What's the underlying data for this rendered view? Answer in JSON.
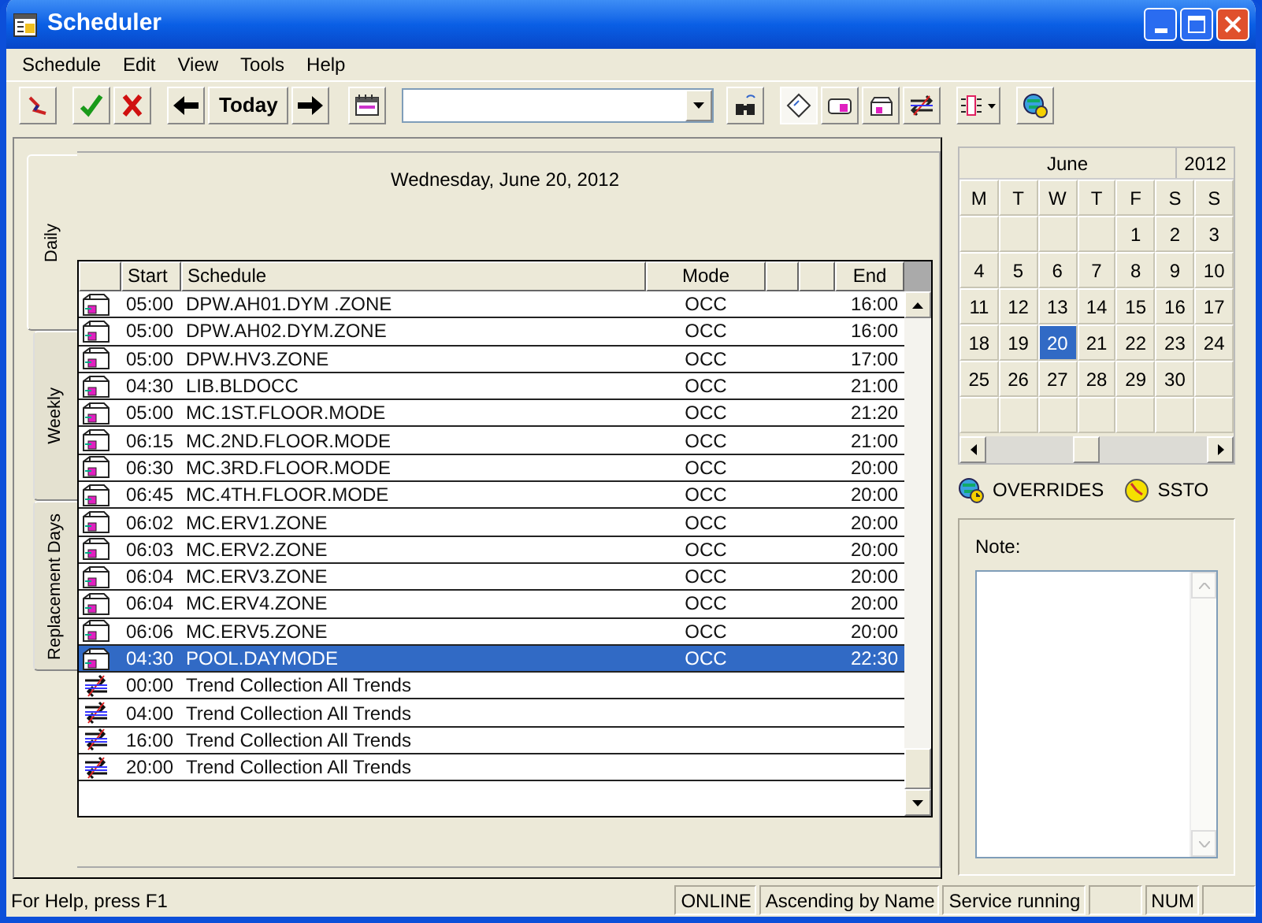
{
  "window": {
    "title": "Scheduler"
  },
  "menu": [
    "Schedule",
    "Edit",
    "View",
    "Tools",
    "Help"
  ],
  "toolbar": {
    "today_label": "Today"
  },
  "tabs": [
    {
      "label": "Daily",
      "selected": true
    },
    {
      "label": "Weekly",
      "selected": false
    },
    {
      "label": "Replacement Days",
      "selected": false
    }
  ],
  "date_heading": "Wednesday, June 20, 2012",
  "table": {
    "columns": [
      "Start",
      "Schedule",
      "Mode",
      "End"
    ],
    "rows": [
      {
        "kind": "schedule",
        "start": "05:00",
        "schedule": "DPW.AH01.DYM .ZONE",
        "mode": "OCC",
        "end": "16:00",
        "selected": false
      },
      {
        "kind": "schedule",
        "start": "05:00",
        "schedule": "DPW.AH02.DYM.ZONE",
        "mode": "OCC",
        "end": "16:00",
        "selected": false
      },
      {
        "kind": "schedule",
        "start": "05:00",
        "schedule": "DPW.HV3.ZONE",
        "mode": "OCC",
        "end": "17:00",
        "selected": false
      },
      {
        "kind": "schedule",
        "start": "04:30",
        "schedule": "LIB.BLDOCC",
        "mode": "OCC",
        "end": "21:00",
        "selected": false
      },
      {
        "kind": "schedule",
        "start": "05:00",
        "schedule": "MC.1ST.FLOOR.MODE",
        "mode": "OCC",
        "end": "21:20",
        "selected": false
      },
      {
        "kind": "schedule",
        "start": "06:15",
        "schedule": "MC.2ND.FLOOR.MODE",
        "mode": "OCC",
        "end": "21:00",
        "selected": false
      },
      {
        "kind": "schedule",
        "start": "06:30",
        "schedule": "MC.3RD.FLOOR.MODE",
        "mode": "OCC",
        "end": "20:00",
        "selected": false
      },
      {
        "kind": "schedule",
        "start": "06:45",
        "schedule": "MC.4TH.FLOOR.MODE",
        "mode": "OCC",
        "end": "20:00",
        "selected": false
      },
      {
        "kind": "schedule",
        "start": "06:02",
        "schedule": "MC.ERV1.ZONE",
        "mode": "OCC",
        "end": "20:00",
        "selected": false
      },
      {
        "kind": "schedule",
        "start": "06:03",
        "schedule": "MC.ERV2.ZONE",
        "mode": "OCC",
        "end": "20:00",
        "selected": false
      },
      {
        "kind": "schedule",
        "start": "06:04",
        "schedule": "MC.ERV3.ZONE",
        "mode": "OCC",
        "end": "20:00",
        "selected": false
      },
      {
        "kind": "schedule",
        "start": "06:04",
        "schedule": "MC.ERV4.ZONE",
        "mode": "OCC",
        "end": "20:00",
        "selected": false
      },
      {
        "kind": "schedule",
        "start": "06:06",
        "schedule": "MC.ERV5.ZONE",
        "mode": "OCC",
        "end": "20:00",
        "selected": false
      },
      {
        "kind": "schedule",
        "start": "04:30",
        "schedule": "POOL.DAYMODE",
        "mode": "OCC",
        "end": "22:30",
        "selected": true
      },
      {
        "kind": "trend",
        "start": "00:00",
        "schedule": "Trend Collection All Trends",
        "selected": false
      },
      {
        "kind": "trend",
        "start": "04:00",
        "schedule": "Trend Collection All Trends",
        "selected": false
      },
      {
        "kind": "trend",
        "start": "16:00",
        "schedule": "Trend Collection All Trends",
        "selected": false
      },
      {
        "kind": "trend",
        "start": "20:00",
        "schedule": "Trend Collection All Trends",
        "selected": false
      }
    ]
  },
  "calendar": {
    "month": "June",
    "year": "2012",
    "weekdays": [
      "M",
      "T",
      "W",
      "T",
      "F",
      "S",
      "S"
    ],
    "weeks": [
      [
        {
          "kind": "blank"
        },
        {
          "kind": "blank"
        },
        {
          "kind": "blank"
        },
        {
          "kind": "blank"
        },
        {
          "day": "1",
          "selected": false
        },
        {
          "day": "2",
          "selected": false
        },
        {
          "day": "3",
          "selected": false
        }
      ],
      [
        {
          "day": "4",
          "selected": false
        },
        {
          "day": "5",
          "selected": false
        },
        {
          "day": "6",
          "selected": false
        },
        {
          "day": "7",
          "selected": false
        },
        {
          "day": "8",
          "selected": false
        },
        {
          "day": "9",
          "selected": false
        },
        {
          "day": "10",
          "selected": false
        }
      ],
      [
        {
          "day": "11",
          "selected": false
        },
        {
          "day": "12",
          "selected": false
        },
        {
          "day": "13",
          "selected": false
        },
        {
          "day": "14",
          "selected": false
        },
        {
          "day": "15",
          "selected": false
        },
        {
          "day": "16",
          "selected": false
        },
        {
          "day": "17",
          "selected": false
        }
      ],
      [
        {
          "day": "18",
          "selected": false
        },
        {
          "day": "19",
          "selected": false
        },
        {
          "day": "20",
          "selected": true
        },
        {
          "day": "21",
          "selected": false
        },
        {
          "day": "22",
          "selected": false
        },
        {
          "day": "23",
          "selected": false
        },
        {
          "day": "24",
          "selected": false
        }
      ],
      [
        {
          "day": "25",
          "selected": false
        },
        {
          "day": "26",
          "selected": false
        },
        {
          "day": "27",
          "selected": false
        },
        {
          "day": "28",
          "selected": false
        },
        {
          "day": "29",
          "selected": false
        },
        {
          "day": "30",
          "selected": false
        },
        {
          "kind": "blank"
        }
      ],
      [
        {
          "kind": "blank"
        },
        {
          "kind": "blank"
        },
        {
          "kind": "blank"
        },
        {
          "kind": "blank"
        },
        {
          "kind": "blank"
        },
        {
          "kind": "blank"
        },
        {
          "kind": "blank"
        }
      ]
    ]
  },
  "legend": [
    "OVERRIDES",
    "SSTO"
  ],
  "note": {
    "label": "Note:"
  },
  "status_bar": [
    "For Help, press F1",
    "ONLINE",
    "Ascending by Name",
    "Service running",
    "NUM"
  ]
}
